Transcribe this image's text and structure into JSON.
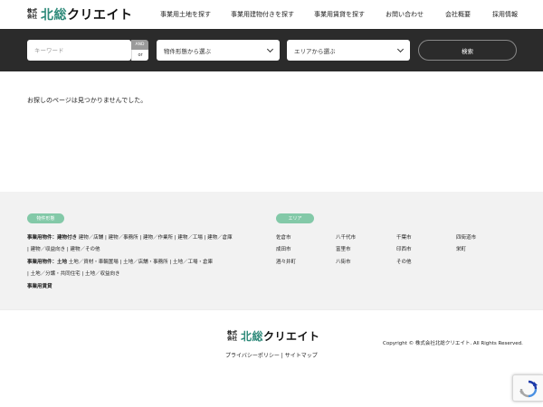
{
  "header": {
    "logo": {
      "kabushiki": "株式",
      "kaisha": "会社",
      "brand_part1": "北総",
      "brand_part2": "クリエイト"
    },
    "nav": [
      {
        "label": "事業用土地を探す"
      },
      {
        "label": "事業用建物付きを探す"
      },
      {
        "label": "事業用賃貸を探す"
      },
      {
        "label": "お問い合わせ"
      },
      {
        "label": "会社概要"
      },
      {
        "label": "採用情報"
      }
    ]
  },
  "search": {
    "keyword_placeholder": "キーワード",
    "keyword_value": "",
    "and_label": "AND",
    "or_label": "or",
    "type_select": "物件形態から選ぶ",
    "area_select": "エリアから選ぶ",
    "submit_label": "検索"
  },
  "main": {
    "message": "お探しのページは見つかりませんでした。"
  },
  "footer": {
    "type_pill": "物件形態",
    "area_pill": "エリア",
    "building_heading": "事業用物件：建物付き",
    "building_row1": "建物／店舗 | 建物／事務所 | 建物／作業所 | 建物／工場 | 建物／倉庫",
    "building_row2": "| 建物／収益向き | 建物／その他",
    "land_heading": "事業用物件：土地",
    "land_row1": "土地／資材・車輛置場 | 土地／店舗・事務所 | 土地／工場・倉庫",
    "land_row2": "| 土地／分譲・共同住宅 | 土地／収益向き",
    "rental_heading": "事業用賃貸",
    "areas": [
      [
        "佐倉市",
        "八千代市",
        "千葉市",
        "四街道市"
      ],
      [
        "成田市",
        "富里市",
        "印西市",
        "栄町"
      ],
      [
        "酒々井町",
        "八街市",
        "その他"
      ]
    ],
    "bottom_links": "プライバシーポリシー | サイトマップ",
    "copyright": "Copyright © 株式会社北総クリエイト. All Rights Reserved."
  },
  "colors": {
    "accent": "#2e8a7a",
    "pill": "#83c9a8",
    "searchbar": "#2b2b2b",
    "footer_bg": "#f2f2f2"
  }
}
